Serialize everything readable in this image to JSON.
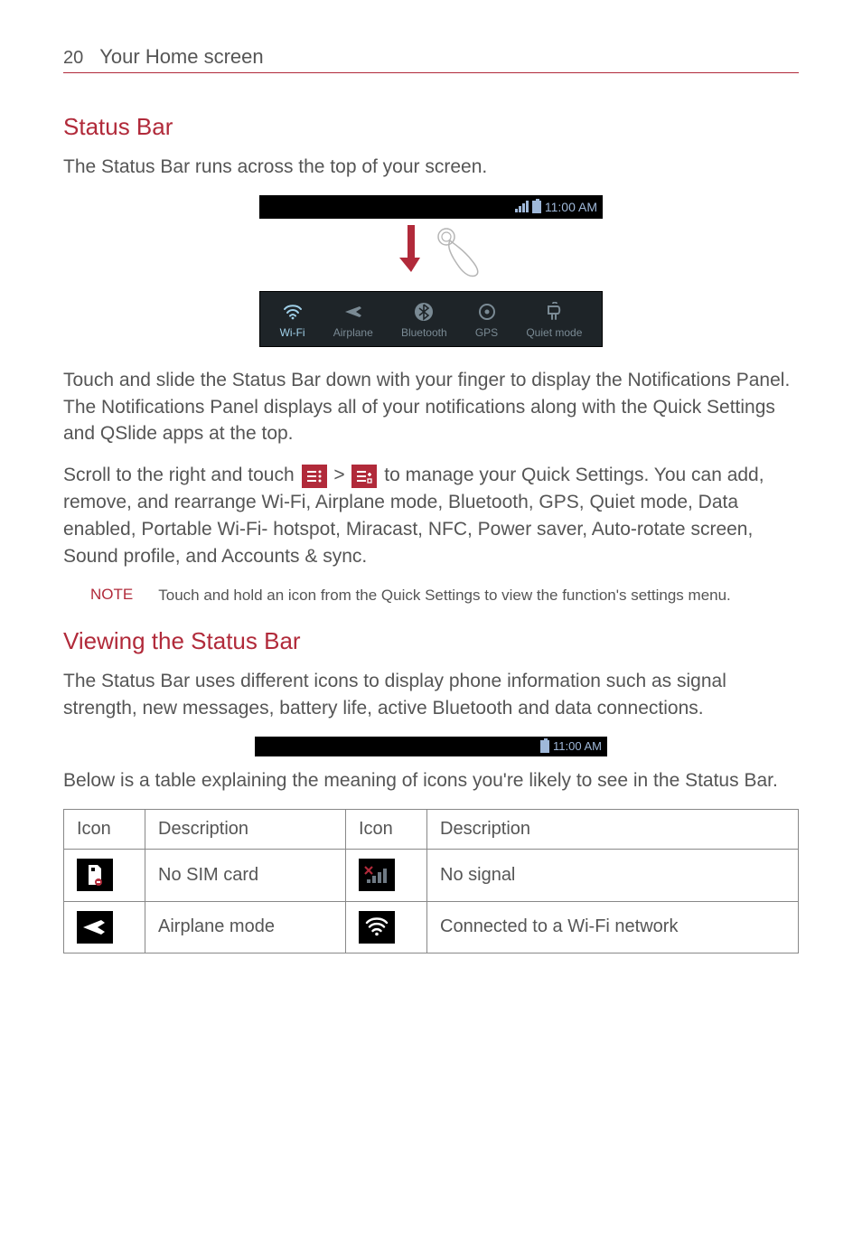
{
  "header": {
    "page_number": "20",
    "title": "Your Home screen"
  },
  "section1": {
    "heading": "Status Bar",
    "intro": "The Status Bar runs across the top of your screen.",
    "status_time": "11:00 AM",
    "quick_items": [
      {
        "label": "Wi-Fi",
        "icon": "wifi-icon",
        "active": true
      },
      {
        "label": "Airplane",
        "icon": "airplane-icon",
        "active": false
      },
      {
        "label": "Bluetooth",
        "icon": "bluetooth-icon",
        "active": false
      },
      {
        "label": "GPS",
        "icon": "gps-icon",
        "active": false
      },
      {
        "label": "Quiet mode",
        "icon": "quiet-icon",
        "active": false
      }
    ],
    "para_after_fig": "Touch and slide the Status Bar down with your finger to display the Notifications Panel. The Notifications Panel displays all of your notifications along with the Quick Settings and QSlide apps at the top.",
    "para_scroll_1": "Scroll to the right and touch ",
    "para_scroll_gt": " > ",
    "para_scroll_2": " to manage your Quick Settings. You can add, remove, and rearrange Wi-Fi, Airplane mode, Bluetooth, GPS, Quiet mode, Data enabled, Portable Wi-Fi- hotspot, Miracast, NFC, Power saver, Auto-rotate screen, Sound profile, and Accounts & sync.",
    "note_label": "NOTE",
    "note_text": "Touch and hold an icon from the Quick Settings to view the function's settings menu."
  },
  "section2": {
    "heading": "Viewing the Status Bar",
    "intro": "The Status Bar uses different icons to display phone information such as signal strength, new messages, battery life, active Bluetooth and data connections.",
    "status_time": "11:00 AM",
    "below_text": "Below is a table explaining the meaning of icons you're likely to see in the Status Bar.",
    "table": {
      "headers": [
        "Icon",
        "Description",
        "Icon",
        "Description"
      ],
      "rows": [
        {
          "icon_a": "no-sim-icon",
          "desc_a": "No SIM card",
          "icon_b": "no-signal-icon",
          "desc_b": "No signal"
        },
        {
          "icon_a": "airplane-mode-icon",
          "desc_a": "Airplane mode",
          "icon_b": "wifi-connected-icon",
          "desc_b": "Connected to a Wi-Fi network"
        }
      ]
    }
  }
}
